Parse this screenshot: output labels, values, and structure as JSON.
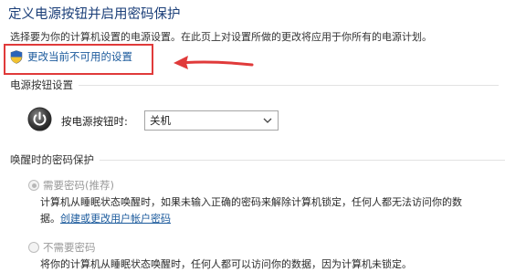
{
  "header": {
    "title": "定义电源按钮并启用密码保护",
    "description": "选择要为你的计算机设置的电源设置。在此页上对设置所做的更改将应用于你所有的电源计划。"
  },
  "change_settings": {
    "icon": "shield-icon",
    "label": "更改当前不可用的设置"
  },
  "annotation": {
    "box_color": "#e03a3a",
    "arrow_color": "#e03a3a"
  },
  "power_button_section": {
    "heading": "电源按钮设置",
    "icon": "power-icon",
    "label": "按电源按钮时:",
    "selected_value": "关机"
  },
  "password_section": {
    "heading": "唤醒时的密码保护",
    "options": [
      {
        "label": "需要密码(推荐)",
        "checked": true,
        "line1": "计算机从睡眠状态唤醒时，如果未输入正确的密码来解除计算机锁定，任何人都无法访问你的数",
        "line2_prefix": "据。",
        "line2_link": "创建或更改用户帐户密码"
      },
      {
        "label": "不需要密码",
        "checked": false,
        "line1": "将你的计算机从睡眠状态唤醒时，任何人都可以访问你的数据，因为计算机未锁定。"
      }
    ]
  }
}
